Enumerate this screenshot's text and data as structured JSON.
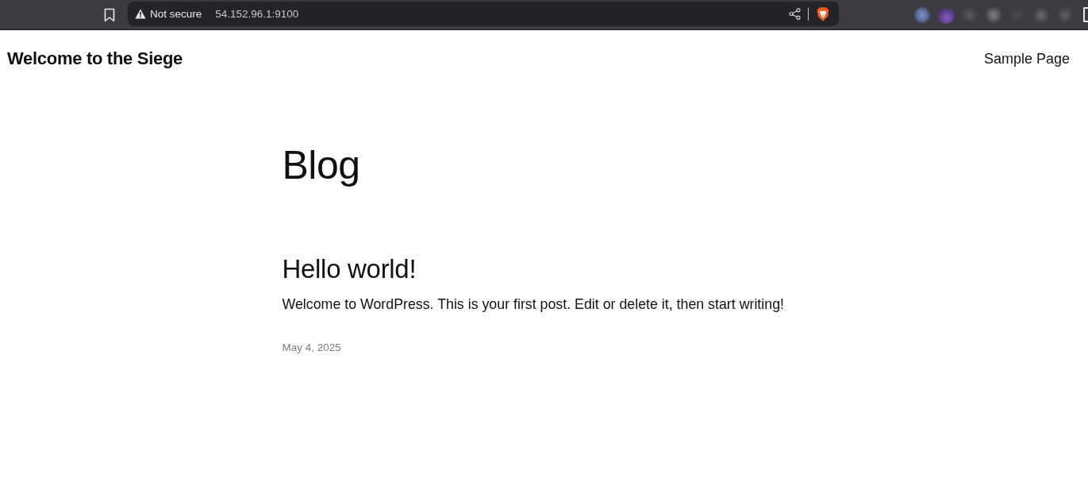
{
  "browser": {
    "security_label": "Not secure",
    "url": "54.152.96.1:9100"
  },
  "site": {
    "title": "Welcome to the Siege",
    "nav": [
      {
        "label": "Sample Page"
      }
    ]
  },
  "page": {
    "title": "Blog",
    "posts": [
      {
        "title": "Hello world!",
        "excerpt": "Welcome to WordPress. This is your first post. Edit or delete it, then start writing!",
        "date": "May 4, 2025"
      }
    ]
  }
}
